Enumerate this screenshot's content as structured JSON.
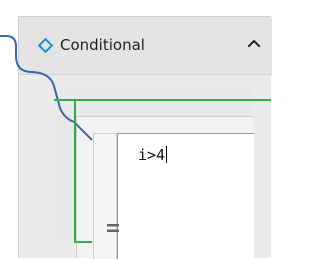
{
  "activity": {
    "title": "Conditional",
    "header_icon": "diamond-icon",
    "collapse_icon": "chevron-up-icon",
    "colors": {
      "accent": "#1e8fd6",
      "flow_blue": "#3a68a6",
      "flow_green": "#2fae4a"
    }
  },
  "expression": {
    "value": "i>4",
    "gutter_icon": "equals-icon"
  }
}
